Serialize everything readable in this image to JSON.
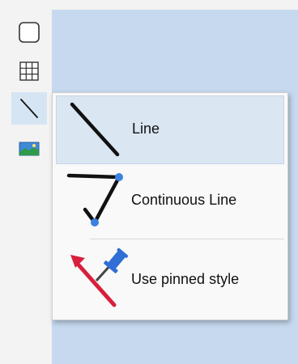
{
  "toolbar": {
    "tools": [
      {
        "icon": "rounded-rectangle-icon"
      },
      {
        "icon": "table-grid-icon"
      },
      {
        "icon": "line-icon",
        "selected": true
      },
      {
        "icon": "image-icon"
      }
    ]
  },
  "menu": {
    "items": [
      {
        "label": "Line",
        "icon": "line-icon",
        "highlighted": true
      },
      {
        "label": "Continuous Line",
        "icon": "continuous-line-icon"
      },
      {
        "label": "Use pinned style",
        "icon": "pinned-style-icon"
      }
    ]
  },
  "colors": {
    "canvas": "#c6d9ef",
    "toolbar": "#f3f3f3",
    "menu_background": "#f9f9f9",
    "highlight": "#dae6f2",
    "node_blue": "#3b82e0",
    "pin_blue": "#2f6fd6",
    "arrow_red": "#d8203c"
  }
}
